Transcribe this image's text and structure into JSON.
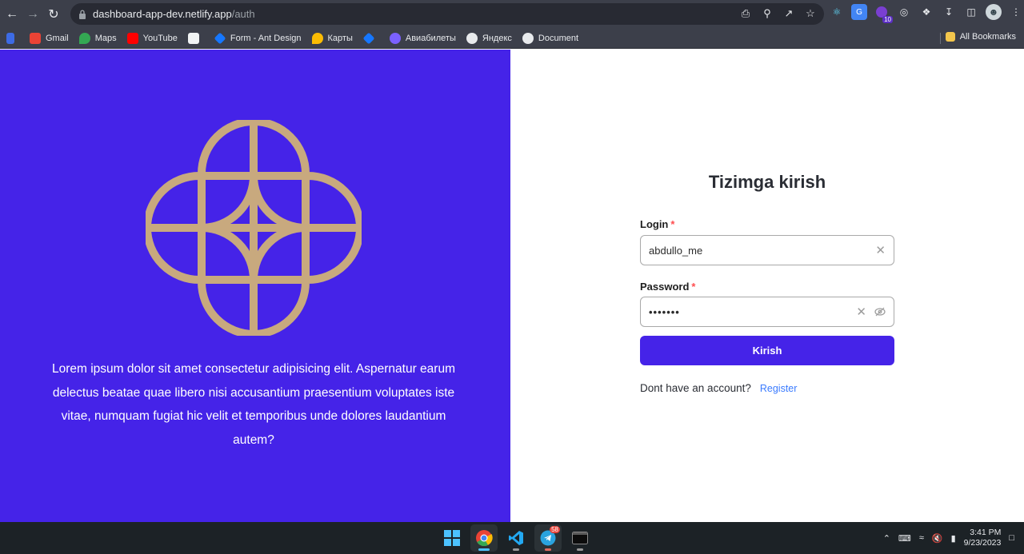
{
  "browser": {
    "url_host": "dashboard-app-dev.netlify.app",
    "url_path": "/auth",
    "ext_badge": "10"
  },
  "bookmarks": {
    "items": [
      {
        "label": "Gmail",
        "icon": "gmail-icon",
        "color": "#ea4335"
      },
      {
        "label": "Maps",
        "icon": "maps-icon",
        "color": "#34a853"
      },
      {
        "label": "YouTube",
        "icon": "youtube-icon",
        "color": "#ff0000"
      },
      {
        "label": "",
        "icon": "calendar-icon",
        "color": "#f1f3f4"
      },
      {
        "label": "Form - Ant Design",
        "icon": "ant-design-icon",
        "color": "#1677ff"
      },
      {
        "label": "Карты",
        "icon": "maps-icon",
        "color": "#fbbc04"
      },
      {
        "label": "",
        "icon": "ant-design-icon",
        "color": "#1677ff"
      },
      {
        "label": "Авиабилеты",
        "icon": "aviasales-icon",
        "color": "#7b61ff"
      },
      {
        "label": "Яндекс",
        "icon": "globe-icon",
        "color": "#e8eaed"
      },
      {
        "label": "Document",
        "icon": "globe-icon",
        "color": "#e8eaed"
      }
    ],
    "all_label": "All Bookmarks"
  },
  "left_panel": {
    "bg": "#4523e8",
    "logo_color": "#c8a97e",
    "text": "Lorem ipsum dolor sit amet consectetur adipisicing elit. Aspernatur earum delectus beatae quae libero nisi accusantium praesentium voluptates iste vitae, numquam fugiat hic velit et temporibus unde dolores laudantium autem?"
  },
  "form": {
    "title": "Tizimga kirish",
    "login_label": "Login",
    "login_value": "abdullo_me",
    "password_label": "Password",
    "password_value": "•••••••",
    "required_mark": "*",
    "submit_label": "Kirish",
    "no_account_text": "Dont have an account?",
    "register_label": "Register"
  },
  "taskbar": {
    "time": "3:41 PM",
    "date": "9/23/2023",
    "telegram_badge": "58"
  }
}
